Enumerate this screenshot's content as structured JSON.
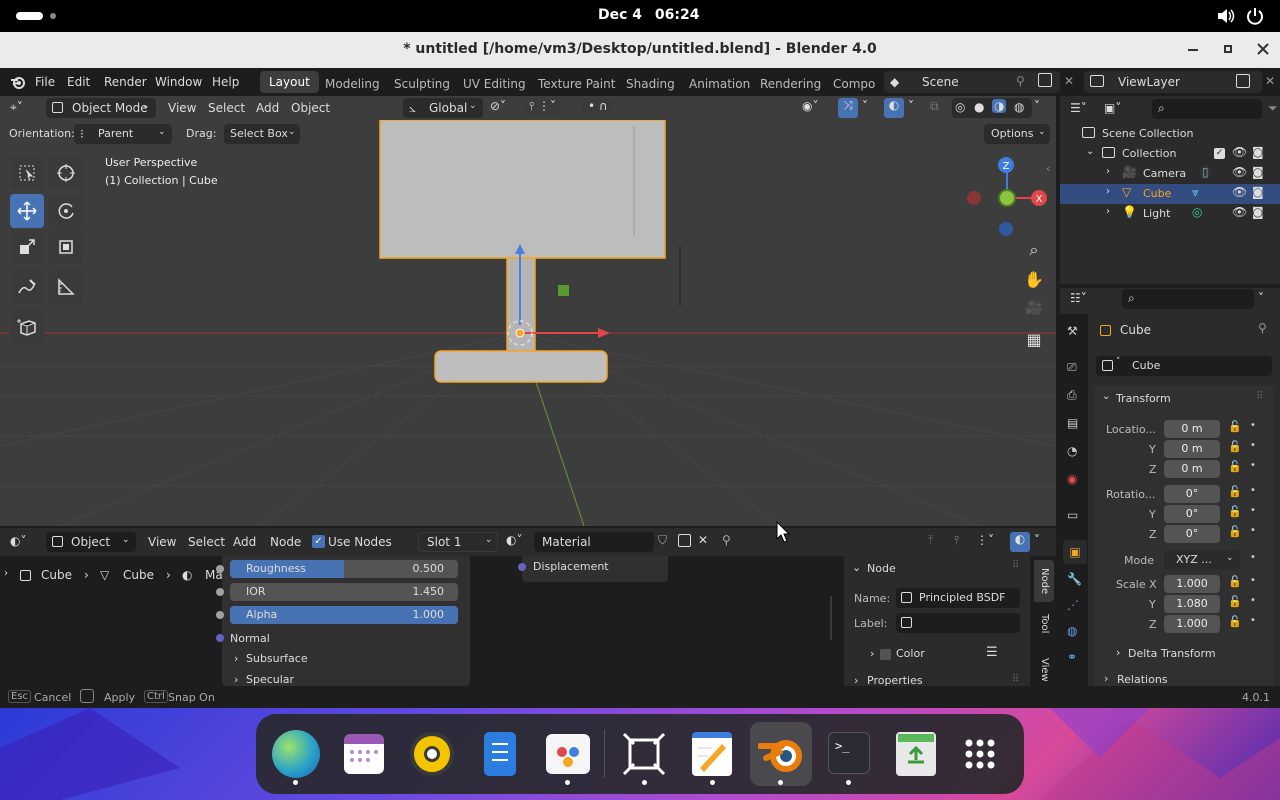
{
  "topbar": {
    "date": "Dec 4",
    "time": "06:24"
  },
  "window": {
    "title": "* untitled [/home/vm3/Desktop/untitled.blend] - Blender 4.0"
  },
  "menu": {
    "items": [
      "File",
      "Edit",
      "Render",
      "Window",
      "Help"
    ]
  },
  "workspaces": {
    "tabs": [
      "Layout",
      "Modeling",
      "Sculpting",
      "UV Editing",
      "Texture Paint",
      "Shading",
      "Animation",
      "Rendering",
      "Compo"
    ],
    "active": "Layout"
  },
  "scene": {
    "name": "Scene"
  },
  "viewlayer": {
    "name": "ViewLayer"
  },
  "viewport": {
    "mode": "Object Mode",
    "menus": [
      "View",
      "Select",
      "Add",
      "Object"
    ],
    "transform": "Global",
    "orientation_label": "Orientation:",
    "orientation_value": "Parent",
    "drag_label": "Drag:",
    "drag_value": "Select Box",
    "options": "Options",
    "perspective": "User Perspective",
    "collection_info": "(1) Collection | Cube",
    "gizmo": {
      "z": "Z",
      "x": "X"
    }
  },
  "node_editor": {
    "editor_type": "Object",
    "menus": [
      "View",
      "Select",
      "Add",
      "Node"
    ],
    "use_nodes": "Use Nodes",
    "slot": "Slot 1",
    "material": "Material",
    "breadcrumb": [
      "Cube",
      "Cube",
      "Material"
    ],
    "sockets": [
      {
        "label": "Roughness",
        "value": "0.500",
        "fill": 0.5
      },
      {
        "label": "IOR",
        "value": "1.450",
        "fill": 0
      },
      {
        "label": "Alpha",
        "value": "1.000",
        "fill": 1.0
      }
    ],
    "normal": "Normal",
    "subsurface": "Subsurface",
    "specular": "Specular",
    "displacement": "Displacement"
  },
  "node_panel": {
    "header": "Node",
    "name_label": "Name:",
    "name_value": "Principled BSDF",
    "label_label": "Label:",
    "color": "Color",
    "properties": "Properties",
    "tabs": [
      "Node",
      "Tool",
      "View"
    ]
  },
  "outliner": {
    "root": "Scene Collection",
    "collection": "Collection",
    "items": [
      "Camera",
      "Cube",
      "Light"
    ],
    "selected": "Cube"
  },
  "properties": {
    "object_name": "Cube",
    "data_name": "Cube",
    "transform": "Transform",
    "location_label": "Locatio...",
    "location": [
      "0 m",
      "0 m",
      "0 m"
    ],
    "rotation_label": "Rotatio...",
    "rotation": [
      "0°",
      "0°",
      "0°"
    ],
    "mode_label": "Mode",
    "mode_value": "XYZ ...",
    "scale_label": "Scale X",
    "scale": [
      "1.000",
      "1.080",
      "1.000"
    ],
    "axes": [
      "Y",
      "Z"
    ],
    "delta": "Delta Transform",
    "relations": "Relations"
  },
  "status": {
    "esc": "Esc",
    "cancel": "Cancel",
    "apply": "Apply",
    "ctrl": "Ctrl",
    "snap": "Snap On",
    "version": "4.0.1"
  },
  "dock": {
    "apps": [
      "web-browser",
      "calendar",
      "rhythmbox",
      "text-editor",
      "software-center",
      "screenshot",
      "notes",
      "blender",
      "terminal",
      "recycle-bin",
      "app-grid"
    ]
  },
  "colors": {
    "accent": "#4772b3",
    "selected_orange": "#f5a623",
    "x_axis": "#e0474b",
    "y_axis": "#8cc43f",
    "z_axis": "#3f7ee0"
  }
}
